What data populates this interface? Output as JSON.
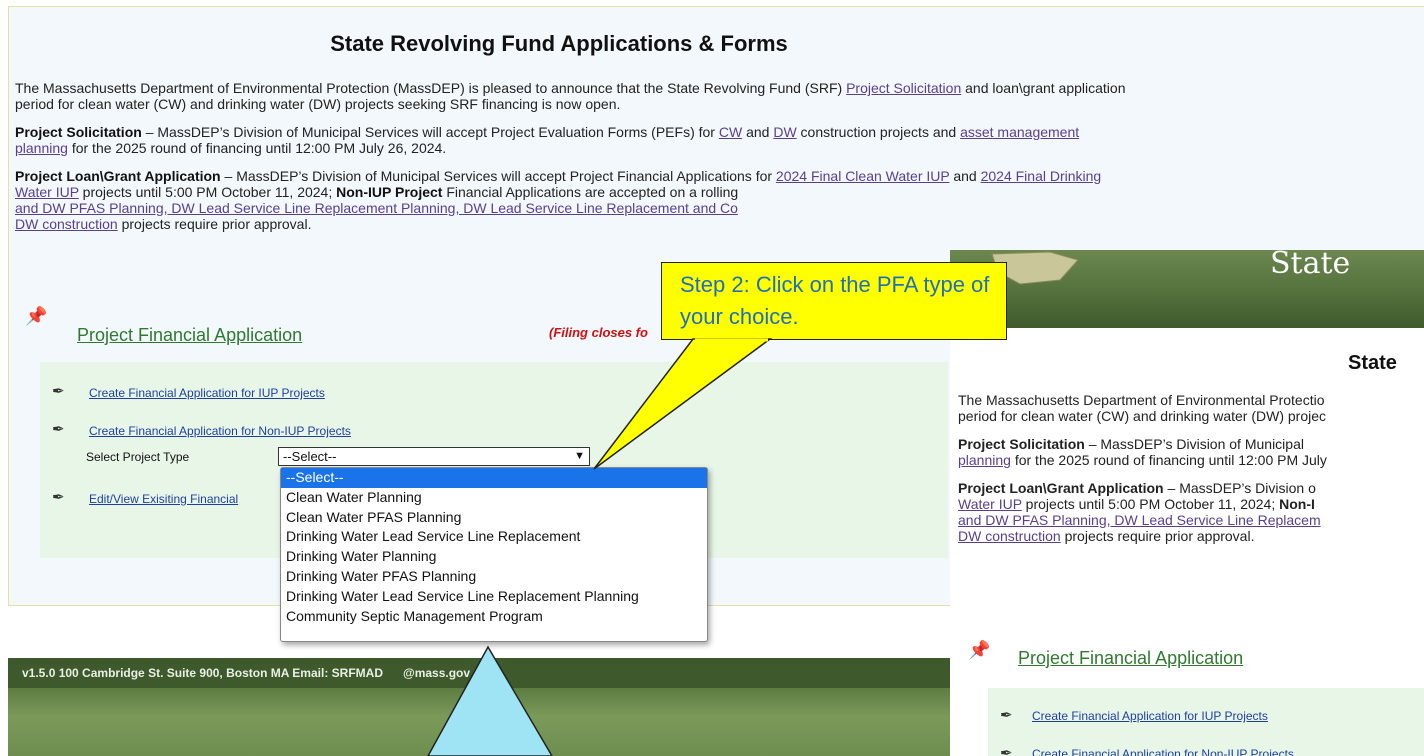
{
  "page": {
    "title": "State Revolving Fund Applications & Forms",
    "intro": {
      "prefix": "The Massachusetts Department of Environmental Protection (MassDEP) is pleased to announce that the State Revolving Fund (SRF) ",
      "link": "Project Solicitation",
      "suffix": " and loan\\grant application",
      "line2": "period for clean water (CW) and drinking water (DW) projects seeking SRF financing is now open."
    },
    "solicitation": {
      "label": "Project Solicitation",
      "text1": " – MassDEP’s Division of Municipal Services will accept Project Evaluation Forms (PEFs) for ",
      "cw_link": "CW",
      "and": " and ",
      "dw_link": "DW",
      "text2": " construction projects and ",
      "asset_link": "asset management",
      "planning_link": "planning",
      "text3": " for the 2025 round of financing until 12:00 PM July 26, 2024."
    },
    "loan": {
      "label": "Project Loan\\Grant Application",
      "text1": " – MassDEP’s Division of Municipal Services will accept Project Financial Applications for ",
      "link1": "2024 Final Clean Water IUP",
      "and": " and ",
      "link2": "2024 Final Drinking",
      "link2b": "Water IUP",
      "text2": " projects until 5:00 PM October 11, 2024; ",
      "nonIUP": "Non-IUP Project",
      "text3": " Financial Applications are accepted on a rolling",
      "links_line3": "and DW PFAS Planning, DW Lead Service Line Replacement Planning, DW Lead Service Line Replacement and Co",
      "dw_construction": "DW construction",
      "text4": " projects require prior approval."
    },
    "section": {
      "title": "Project Financial Application",
      "filing_note": "(Filing closes fo"
    },
    "links": {
      "iup": "Create Financial Application for IUP Projects",
      "non_iup": "Create Financial Application for Non-IUP Projects",
      "edit": "Edit/View Exisiting Financial"
    },
    "select": {
      "label": "Select Project Type",
      "value": "--Select--",
      "options": [
        "--Select--",
        "Clean Water Planning",
        "Clean Water PFAS Planning",
        "Drinking Water Lead Service Line Replacement",
        "Drinking Water Planning",
        "Drinking Water PFAS Planning",
        "Drinking Water Lead Service Line Replacement Planning",
        "Community Septic Management Program"
      ]
    },
    "footer": {
      "text": "v1.5.0   100 Cambridge St. Suite 900, Boston MA   Email: SRFMAD",
      "email_tail": "@mass.gov"
    }
  },
  "right_panel": {
    "banner_title": "State",
    "title": "State",
    "p1_line1": "The Massachusetts Department of Environmental Protectio",
    "p1_line2": "period for clean water (CW) and drinking water (DW) projec",
    "p2_label": "Project Solicitation",
    "p2_text": " – MassDEP’s Division of Municipal ",
    "p2_link": "planning",
    "p2_text2": " for the 2025 round of financing until 12:00 PM July",
    "p3_label": "Project Loan\\Grant Application",
    "p3_text": " – MassDEP’s Division o",
    "p3_link": "Water IUP",
    "p3_text2": " projects until 5:00 PM October 11, 2024; ",
    "p3_bold": "Non-I",
    "p3_link2": "and DW PFAS Planning, DW Lead Service Line Replacem",
    "p3_link3": "DW construction",
    "p3_text3": " projects require prior approval.",
    "section_title": "Project Financial Application",
    "link_iup": "Create Financial Application for IUP Projects",
    "link_non_iup": "Create Financial Application for Non-IUP Projects"
  },
  "callout": {
    "text": "Step 2: Click on the PFA type of your choice.",
    "color": "#ffff00",
    "text_color": "#1f6fbf"
  },
  "icons": [
    "pushpin-icon",
    "feather-pen-icon",
    "chevron-down-icon"
  ]
}
